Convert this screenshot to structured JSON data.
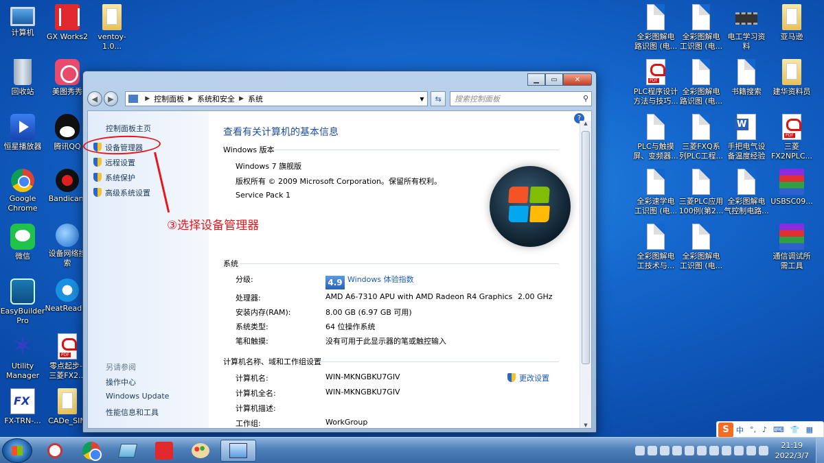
{
  "desktop_left": [
    {
      "label": "计算机",
      "icon": "computer-icon",
      "cls": "mon"
    },
    {
      "label": "回收站",
      "icon": "recycle-bin-icon",
      "cls": "trash"
    },
    {
      "label": "恒星播放器",
      "icon": "player-icon",
      "cls": "blue"
    },
    {
      "label": "Google\nChrome",
      "icon": "chrome-icon",
      "cls": "chrome"
    },
    {
      "label": "微信",
      "icon": "wechat-icon",
      "cls": "wechat"
    },
    {
      "label": "EasyBuilder\nPro",
      "icon": "easybuilder-icon",
      "cls": "teal"
    },
    {
      "label": "Utility\nManager",
      "icon": "utility-manager-icon",
      "cls": "star"
    },
    {
      "label": "FX-TRN-...",
      "icon": "fx-trn-icon",
      "cls": "fx"
    }
  ],
  "desktop_left2": [
    {
      "label": "GX Works2",
      "icon": "gx-works2-icon",
      "cls": "red"
    },
    {
      "label": "美图秀秀",
      "icon": "meitu-icon",
      "cls": "pink"
    },
    {
      "label": "腾讯QQ",
      "icon": "qq-icon",
      "cls": "qq"
    },
    {
      "label": "Bandicam",
      "icon": "bandicam-icon",
      "cls": "rec"
    },
    {
      "label": "设备网络搜\n索",
      "icon": "network-search-icon",
      "cls": "net"
    },
    {
      "label": "NeatReader",
      "icon": "neatreader-icon",
      "cls": "teal2"
    },
    {
      "label": "零点起步--\n三菱FX2...",
      "icon": "pdf-icon",
      "cls": "pdf"
    },
    {
      "label": "CADe_SIM",
      "icon": "folder-icon",
      "cls": "folder"
    }
  ],
  "desktop_left3": [
    {
      "label": "ventoy-1.0...",
      "icon": "folder-icon",
      "cls": "folder"
    }
  ],
  "desktop_right": [
    [
      {
        "label": "全彩图解电\n路识图 (电...",
        "cls": "doc"
      },
      {
        "label": "全彩图解电\n工识图 (电...",
        "cls": "doc"
      },
      {
        "label": "电工学习资\n料",
        "cls": "chip"
      },
      {
        "label": "亚马逊",
        "cls": "folder"
      }
    ],
    [
      {
        "label": "PLC程序设计\n方法与技巧...",
        "cls": "pdf"
      },
      {
        "label": "全彩图解电\n路识图 (电...",
        "cls": "doc"
      },
      {
        "label": "书籍搜索",
        "cls": "doc"
      },
      {
        "label": "建华资料员",
        "cls": "folder"
      }
    ],
    [
      {
        "label": "PLC与触摸\n屏、变频器...",
        "cls": "doc"
      },
      {
        "label": "三菱FXQ系\n列PLC工程...",
        "cls": "doc"
      },
      {
        "label": "手把电气设\n备温度经验",
        "cls": "word"
      },
      {
        "label": "三菱\nFX2NPLC...",
        "cls": "pdf"
      }
    ],
    [
      {
        "label": "全彩速学电\n工识图 (电...",
        "cls": "doc"
      },
      {
        "label": "三菱PLC应用\n100例(第2...",
        "cls": "doc"
      },
      {
        "label": "全彩图解电\n气控制电路...",
        "cls": "doc"
      },
      {
        "label": "USBSC09...",
        "cls": "rar"
      }
    ],
    [
      {
        "label": "全彩图解电\n工技术与...",
        "cls": "doc"
      },
      {
        "label": "全彩图解电\n工识图 (电...",
        "cls": "doc"
      },
      null,
      {
        "label": "通信调试所\n需工具",
        "cls": "rar"
      }
    ]
  ],
  "window": {
    "breadcrumb": [
      "控制面板",
      "系统和安全",
      "系统"
    ],
    "search_placeholder": "搜索控制面板",
    "left_home": "控制面板主页",
    "left_links": [
      "设备管理器",
      "远程设置",
      "系统保护",
      "高级系统设置"
    ],
    "see_also_title": "另请参阅",
    "see_also": [
      "操作中心",
      "Windows Update",
      "性能信息和工具"
    ],
    "title": "查看有关计算机的基本信息",
    "edition_title": "Windows 版本",
    "edition": [
      "Windows 7 旗舰版",
      "版权所有 © 2009 Microsoft Corporation。保留所有权利。",
      "Service Pack 1"
    ],
    "system_title": "系统",
    "rating_label": "分级:",
    "rating_score": "4.9",
    "rating_link": "Windows 体验指数",
    "system_rows": [
      {
        "k": "处理器:",
        "v": "AMD A6-7310 APU with AMD Radeon R4 Graphics",
        "v2": "2.00 GHz"
      },
      {
        "k": "安装内存(RAM):",
        "v": "8.00 GB (6.97 GB 可用)",
        "v2": ""
      },
      {
        "k": "系统类型:",
        "v": "64 位操作系统",
        "v2": ""
      },
      {
        "k": "笔和触摸:",
        "v": "没有可用于此显示器的笔或触控输入",
        "v2": ""
      }
    ],
    "name_title": "计算机名称、域和工作组设置",
    "change_settings": "更改设置",
    "name_rows": [
      {
        "k": "计算机名:",
        "v": "WIN-MKNGBKU7GIV"
      },
      {
        "k": "计算机全名:",
        "v": "WIN-MKNGBKU7GIV"
      },
      {
        "k": "计算机描述:",
        "v": ""
      },
      {
        "k": "工作组:",
        "v": "WorkGroup"
      }
    ]
  },
  "annotation": "③选择设备管理器",
  "taskbar": {
    "time": "21:19",
    "date": "2022/3/7"
  },
  "ime": {
    "logo": "S",
    "items": [
      "中",
      "°,",
      "♪",
      "⌨",
      "👕",
      "▦"
    ]
  }
}
